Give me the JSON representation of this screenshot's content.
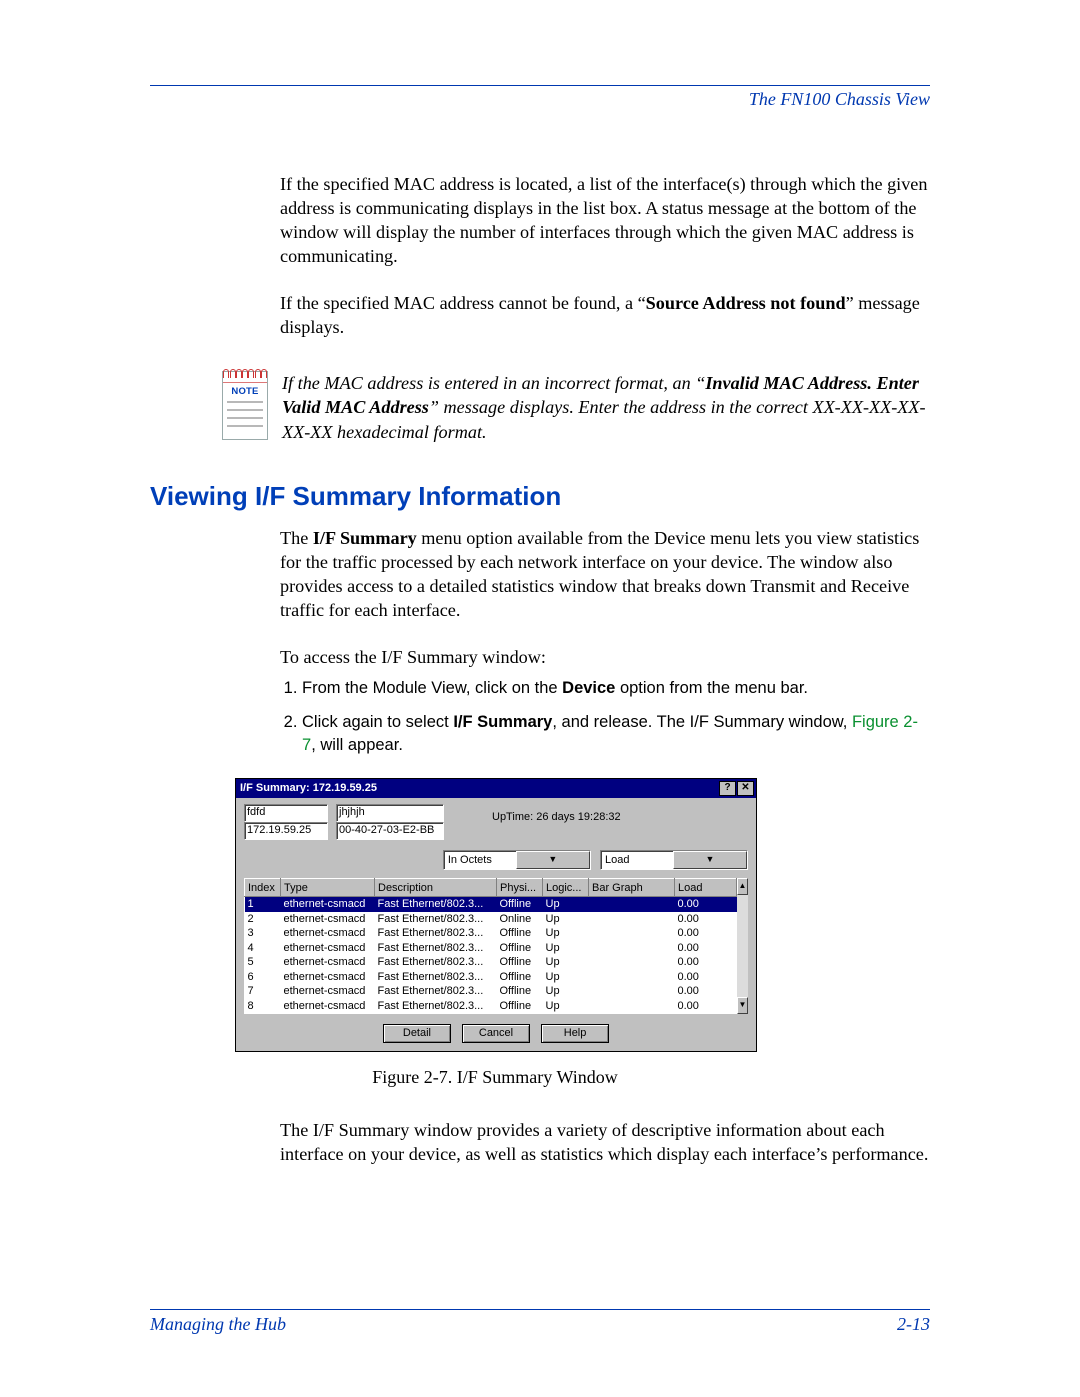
{
  "header": {
    "running_title": "The FN100 Chassis View"
  },
  "body": {
    "para1_pre": "If the specified MAC address is located, a list of the interface(s) through which the given address is communicating displays in the list box. A status message at the bottom of the window will display the number of interfaces through which the given MAC address is communicating.",
    "para2_pre": "If the specified MAC address cannot be found, a “",
    "para2_bold": "Source Address not found",
    "para2_post": "” message displays."
  },
  "note": {
    "label": "NOTE",
    "text_pre": "If the MAC address is entered in an incorrect format, an “",
    "bold1": "Invalid MAC Address. Enter Valid MAC Address",
    "text_post": "” message displays. Enter the address in the correct XX-XX-XX-XX-XX-XX hexadecimal format."
  },
  "section": {
    "heading": "Viewing I/F Summary Information",
    "intro_pre": "The ",
    "intro_bold": "I/F Summary",
    "intro_post": " menu option available from the Device menu lets you view statistics for the traffic processed by each network interface on your device. The window also provides access to a detailed statistics window that breaks down Transmit and Receive traffic for each interface.",
    "access_line": "To access the I/F Summary window:",
    "steps": [
      {
        "pre": "From the Module View, click on the ",
        "b": "Device",
        "post": " option from the menu bar."
      },
      {
        "pre": "Click again to select ",
        "b": "I/F Summary",
        "post": ", and release. The I/F Summary window, ",
        "figref": "Figure 2-7",
        "post2": ", will appear."
      }
    ]
  },
  "dialog": {
    "title": "I/F Summary: 172.19.59.25",
    "btn_help_glyph": "?",
    "btn_close_glyph": "✕",
    "fields": {
      "f1": "fdfd",
      "f2": "jhjhjh",
      "f3": "172.19.59.25",
      "f4": "00-40-27-03-E2-BB"
    },
    "uptime": "UpTime: 26 days 19:28:32",
    "combo1": "In Octets",
    "combo2": "Load",
    "columns": [
      "Index",
      "Type",
      "Description",
      "Physi...",
      "Logic...",
      "Bar Graph",
      "Load"
    ],
    "rows": [
      {
        "idx": "1",
        "type": "ethernet-csmacd",
        "desc": "Fast Ethernet/802.3...",
        "phy": "Offline",
        "log": "Up",
        "bar": "",
        "load": "0.00"
      },
      {
        "idx": "2",
        "type": "ethernet-csmacd",
        "desc": "Fast Ethernet/802.3...",
        "phy": "Online",
        "log": "Up",
        "bar": "",
        "load": "0.00"
      },
      {
        "idx": "3",
        "type": "ethernet-csmacd",
        "desc": "Fast Ethernet/802.3...",
        "phy": "Offline",
        "log": "Up",
        "bar": "",
        "load": "0.00"
      },
      {
        "idx": "4",
        "type": "ethernet-csmacd",
        "desc": "Fast Ethernet/802.3...",
        "phy": "Offline",
        "log": "Up",
        "bar": "",
        "load": "0.00"
      },
      {
        "idx": "5",
        "type": "ethernet-csmacd",
        "desc": "Fast Ethernet/802.3...",
        "phy": "Offline",
        "log": "Up",
        "bar": "",
        "load": "0.00"
      },
      {
        "idx": "6",
        "type": "ethernet-csmacd",
        "desc": "Fast Ethernet/802.3...",
        "phy": "Offline",
        "log": "Up",
        "bar": "",
        "load": "0.00"
      },
      {
        "idx": "7",
        "type": "ethernet-csmacd",
        "desc": "Fast Ethernet/802.3...",
        "phy": "Offline",
        "log": "Up",
        "bar": "",
        "load": "0.00"
      },
      {
        "idx": "8",
        "type": "ethernet-csmacd",
        "desc": "Fast Ethernet/802.3...",
        "phy": "Offline",
        "log": "Up",
        "bar": "",
        "load": "0.00"
      }
    ],
    "buttons": {
      "detail": "Detail",
      "cancel": "Cancel",
      "help": "Help"
    },
    "scroll_up": "▲",
    "scroll_down": "▼",
    "combo_arrow": "▼"
  },
  "figure_caption": "Figure 2-7.  I/F Summary Window",
  "closing_para": "The I/F Summary window provides a variety of descriptive information about each interface on your device, as well as statistics which display each interface’s performance.",
  "footer": {
    "left": "Managing the Hub",
    "right": "2-13"
  }
}
